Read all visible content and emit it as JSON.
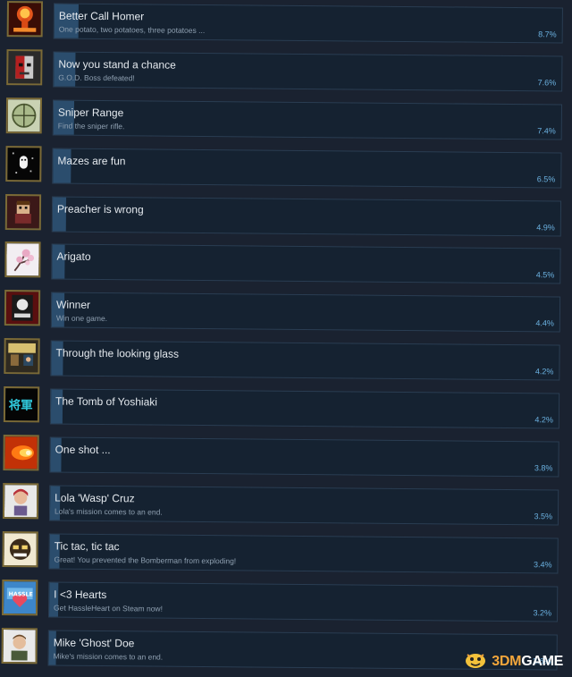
{
  "colors": {
    "background": "#1a2230",
    "bar": "#152231",
    "fill": "#2b4d6d",
    "percent": "#6bb1e0",
    "icon_border": "#7b6a36"
  },
  "achievements": [
    {
      "name": "Better Call Homer",
      "desc": "One potato, two potatoes, three potatoes ...",
      "percent": "8.7%",
      "fill": 0.087,
      "icon": "mushroom-cloud-icon"
    },
    {
      "name": "Now you stand a chance",
      "desc": "G.O.D. Boss defeated!",
      "percent": "7.6%",
      "fill": 0.076,
      "icon": "robot-face-icon"
    },
    {
      "name": "Sniper Range",
      "desc": "Find the sniper rifle.",
      "percent": "7.4%",
      "fill": 0.074,
      "icon": "scope-icon"
    },
    {
      "name": "Mazes are fun",
      "desc": "",
      "percent": "6.5%",
      "fill": 0.065,
      "icon": "ghost-maze-icon"
    },
    {
      "name": "Preacher is wrong",
      "desc": "",
      "percent": "4.9%",
      "fill": 0.049,
      "icon": "pixel-character-icon"
    },
    {
      "name": "Arigato",
      "desc": "",
      "percent": "4.5%",
      "fill": 0.045,
      "icon": "cherry-blossom-icon"
    },
    {
      "name": "Winner",
      "desc": "Win one game.",
      "percent": "4.4%",
      "fill": 0.044,
      "icon": "peace-poster-icon"
    },
    {
      "name": "Through the looking glass",
      "desc": "",
      "percent": "4.2%",
      "fill": 0.042,
      "icon": "room-scene-icon"
    },
    {
      "name": "The Tomb of Yoshiaki",
      "desc": "",
      "percent": "4.2%",
      "fill": 0.042,
      "icon": "kanji-sign-icon"
    },
    {
      "name": "One shot ...",
      "desc": "",
      "percent": "3.8%",
      "fill": 0.038,
      "icon": "fireball-icon"
    },
    {
      "name": "Lola 'Wasp' Cruz",
      "desc": "Lola's mission comes to an end.",
      "percent": "3.5%",
      "fill": 0.035,
      "icon": "lola-portrait-icon"
    },
    {
      "name": "Tic tac, tic tac",
      "desc": "Great! You prevented the Bomberman from exploding!",
      "percent": "3.4%",
      "fill": 0.034,
      "icon": "bomber-face-icon"
    },
    {
      "name": "I <3 Hearts",
      "desc": "Get HassleHeart on Steam now!",
      "percent": "3.2%",
      "fill": 0.032,
      "icon": "hassleheart-logo-icon"
    },
    {
      "name": "Mike 'Ghost' Doe",
      "desc": "Mike's mission comes to an end.",
      "percent": "2.6%",
      "fill": 0.026,
      "icon": "mike-portrait-icon"
    }
  ],
  "watermark": {
    "num": "3DM",
    "text": "GAME"
  }
}
